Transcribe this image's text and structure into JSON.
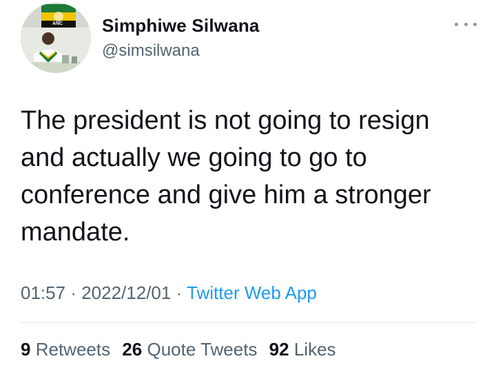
{
  "tweet": {
    "author": {
      "display_name": "Simphiwe Silwana",
      "handle": "@simsilwana",
      "avatar_flag_text": "ANC"
    },
    "more_icon": "more-dots-icon",
    "text": "The president is not going to resign\nand actually we going to go to\nconference and give him a stronger\nmandate.",
    "time": "01:57",
    "separator": "·",
    "date": "2022/12/01",
    "source": "Twitter Web App",
    "stats": {
      "retweets_count": "9",
      "retweets_label": "Retweets",
      "quote_tweets_count": "26",
      "quote_tweets_label": "Quote Tweets",
      "likes_count": "92",
      "likes_label": "Likes"
    }
  },
  "colors": {
    "text": "#0f1419",
    "secondary": "#536471",
    "link": "#1d9bf0",
    "divider": "#e1e8ed"
  }
}
